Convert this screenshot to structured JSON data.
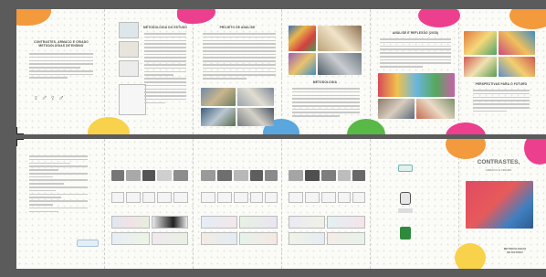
{
  "spread_top": {
    "panel1": {
      "title_line1": "CONTRASTES, ARMACO E CRIADO",
      "title_line2": "METODOLOGIAS DE ENSINO"
    },
    "panel2": {
      "title": "METODOLOGIA DO ESTUDO"
    },
    "panel3": {
      "title": "PROJETO DE ANÁLISE"
    },
    "panel4": {
      "title": "METODOLOGIA"
    },
    "panel5": {
      "title": "ANÁLISE E REFLEXÃO (2018)"
    },
    "panel6": {
      "title": "PERSPECTIVAS PARA O FUTURO"
    }
  },
  "spread_bottom": {
    "cover": {
      "title_line1": "CONTRASTES,",
      "title_line2": "ARMACO E CRIADO",
      "footer_line1": "METODOLOGIAS",
      "footer_line2": "DE ESTUDO"
    }
  },
  "colors": {
    "orange": "#f39a3c",
    "pink": "#ec3f8e",
    "yellow": "#f8d24a",
    "green": "#59b946",
    "blue": "#5aa6de",
    "sheet": "#fbfbf8",
    "background": "#5b5b5b"
  }
}
